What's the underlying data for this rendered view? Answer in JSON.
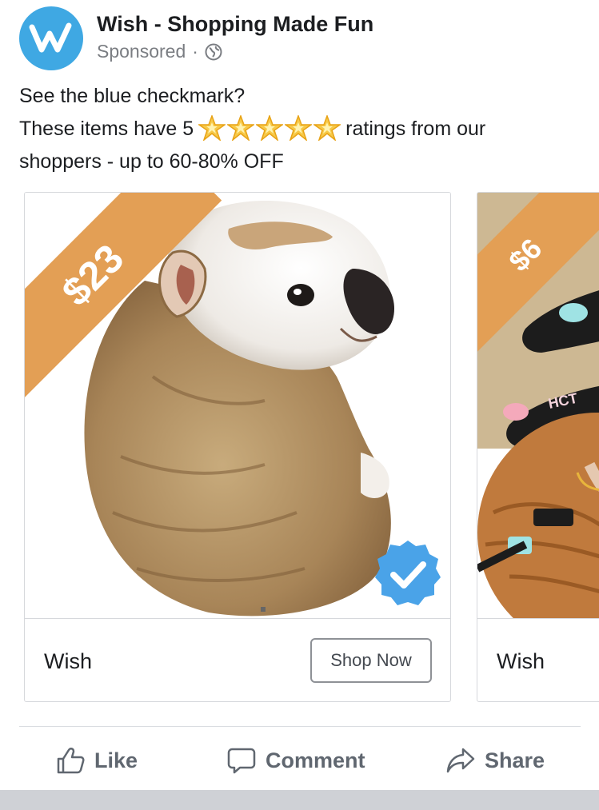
{
  "post": {
    "page_name": "Wish - Shopping Made Fun",
    "sponsored_label": "Sponsored",
    "separator": "·",
    "line1": "See the blue checkmark?",
    "line2_before": "These items have 5",
    "line2_after": "ratings from our",
    "line3": "shoppers - up to 60-80% OFF",
    "star_count": 5
  },
  "cards": [
    {
      "price": "$23",
      "brand": "Wish",
      "cta": "Shop Now",
      "verified": true
    },
    {
      "price": "$6",
      "brand": "Wish"
    }
  ],
  "actions": {
    "like": "Like",
    "comment": "Comment",
    "share": "Share"
  },
  "icons": {
    "avatar": "wish-logo-icon",
    "globe": "globe-icon",
    "star": "star-emoji-icon",
    "badge": "verified-checkmark-icon",
    "like": "thumbs-up-icon",
    "comment": "comment-bubble-icon",
    "share": "share-arrow-icon"
  },
  "colors": {
    "brand_blue": "#3fa8e3",
    "price_orange": "#e39f55",
    "verified_blue": "#4aa3e8",
    "muted_text": "#606770"
  }
}
